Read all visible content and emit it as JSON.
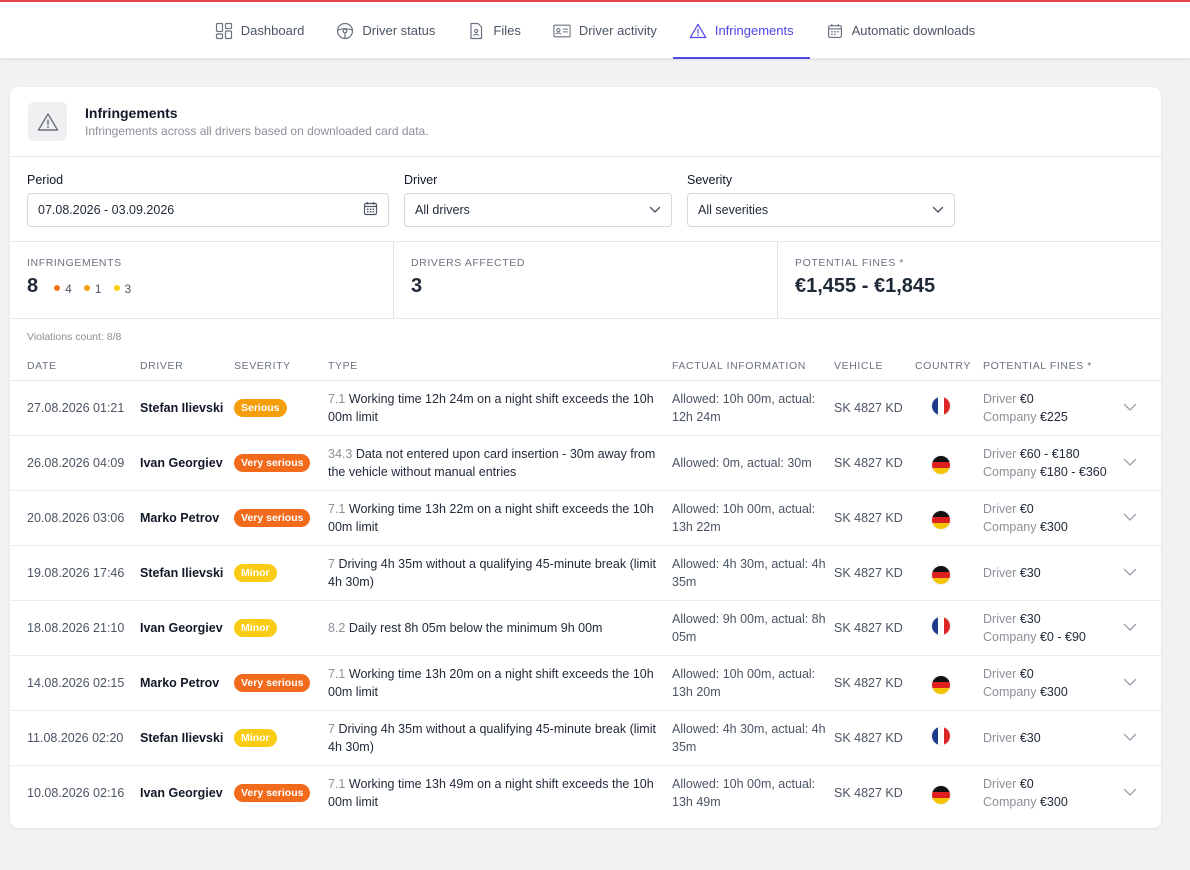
{
  "nav": {
    "tabs": [
      {
        "label": "Dashboard",
        "icon": "dashboard-icon"
      },
      {
        "label": "Driver status",
        "icon": "steering-wheel-icon"
      },
      {
        "label": "Files",
        "icon": "file-icon"
      },
      {
        "label": "Driver activity",
        "icon": "id-card-icon"
      },
      {
        "label": "Infringements",
        "icon": "warning-icon",
        "active": true
      },
      {
        "label": "Automatic downloads",
        "icon": "calendar-icon"
      }
    ]
  },
  "header": {
    "title": "Infringements",
    "subtitle": "Infringements across all drivers based on downloaded card data."
  },
  "filters": {
    "period_label": "Period",
    "period_value": "07.08.2026 - 03.09.2026",
    "driver_label": "Driver",
    "driver_value": "All drivers",
    "severity_label": "Severity",
    "severity_value": "All severities"
  },
  "stats": {
    "infringements_label": "INFRINGEMENTS",
    "infringements_value": "8",
    "breakdown": [
      {
        "count": "4",
        "color": "#f97316"
      },
      {
        "count": "1",
        "color": "#f59e0b"
      },
      {
        "count": "3",
        "color": "#facc15"
      }
    ],
    "drivers_label": "DRIVERS AFFECTED",
    "drivers_value": "3",
    "fines_label": "POTENTIAL FINES *",
    "fines_value": "€1,455 - €1,845"
  },
  "violations_count": "Violations count: 8/8",
  "table": {
    "headers": [
      "DATE",
      "DRIVER",
      "SEVERITY",
      "TYPE",
      "FACTUAL INFORMATION",
      "VEHICLE",
      "COUNTRY",
      "POTENTIAL FINES *"
    ],
    "colors": {
      "Serious": "#f59e0b",
      "Very serious": "#f26a1b",
      "Minor": "#facc15"
    },
    "rows": [
      {
        "date": "27.08.2026 01:21",
        "driver": "Stefan Ilievski",
        "severity": "Serious",
        "code": "7.1",
        "type": "Working time 12h 24m on a night shift exceeds the 10h 00m limit",
        "fact": "Allowed: 10h 00m, actual: 12h 24m",
        "vehicle": "SK 4827 KD",
        "country": "fr",
        "driver_fine_label": "Driver",
        "driver_fine": "€0",
        "company_fine_label": "Company",
        "company_fine": "€225"
      },
      {
        "date": "26.08.2026 04:09",
        "driver": "Ivan Georgiev",
        "severity": "Very serious",
        "code": "34.3",
        "type": "Data not entered upon card insertion - 30m away from the vehicle without manual entries",
        "fact": "Allowed: 0m, actual: 30m",
        "vehicle": "SK 4827 KD",
        "country": "de",
        "driver_fine_label": "Driver",
        "driver_fine": "€60 - €180",
        "company_fine_label": "Company",
        "company_fine": "€180 - €360"
      },
      {
        "date": "20.08.2026 03:06",
        "driver": "Marko Petrov",
        "severity": "Very serious",
        "code": "7.1",
        "type": "Working time 13h 22m on a night shift exceeds the 10h 00m limit",
        "fact": "Allowed: 10h 00m, actual: 13h 22m",
        "vehicle": "SK 4827 KD",
        "country": "de",
        "driver_fine_label": "Driver",
        "driver_fine": "€0",
        "company_fine_label": "Company",
        "company_fine": "€300"
      },
      {
        "date": "19.08.2026 17:46",
        "driver": "Stefan Ilievski",
        "severity": "Minor",
        "code": "7",
        "type": "Driving 4h 35m without a qualifying 45-minute break (limit 4h 30m)",
        "fact": "Allowed: 4h 30m, actual: 4h 35m",
        "vehicle": "SK 4827 KD",
        "country": "de",
        "driver_fine_label": "Driver",
        "driver_fine": "€30",
        "company_fine_label": "",
        "company_fine": ""
      },
      {
        "date": "18.08.2026 21:10",
        "driver": "Ivan Georgiev",
        "severity": "Minor",
        "code": "8.2",
        "type": "Daily rest 8h 05m below the minimum 9h 00m",
        "fact": "Allowed: 9h 00m, actual: 8h 05m",
        "vehicle": "SK 4827 KD",
        "country": "fr",
        "driver_fine_label": "Driver",
        "driver_fine": "€30",
        "company_fine_label": "Company",
        "company_fine": "€0 - €90"
      },
      {
        "date": "14.08.2026 02:15",
        "driver": "Marko Petrov",
        "severity": "Very serious",
        "code": "7.1",
        "type": "Working time 13h 20m on a night shift exceeds the 10h 00m limit",
        "fact": "Allowed: 10h 00m, actual: 13h 20m",
        "vehicle": "SK 4827 KD",
        "country": "de",
        "driver_fine_label": "Driver",
        "driver_fine": "€0",
        "company_fine_label": "Company",
        "company_fine": "€300"
      },
      {
        "date": "11.08.2026 02:20",
        "driver": "Stefan Ilievski",
        "severity": "Minor",
        "code": "7",
        "type": "Driving 4h 35m without a qualifying 45-minute break (limit 4h 30m)",
        "fact": "Allowed: 4h 30m, actual: 4h 35m",
        "vehicle": "SK 4827 KD",
        "country": "fr",
        "driver_fine_label": "Driver",
        "driver_fine": "€30",
        "company_fine_label": "",
        "company_fine": ""
      },
      {
        "date": "10.08.2026 02:16",
        "driver": "Ivan Georgiev",
        "severity": "Very serious",
        "code": "7.1",
        "type": "Working time 13h 49m on a night shift exceeds the 10h 00m limit",
        "fact": "Allowed: 10h 00m, actual: 13h 49m",
        "vehicle": "SK 4827 KD",
        "country": "de",
        "driver_fine_label": "Driver",
        "driver_fine": "€0",
        "company_fine_label": "Company",
        "company_fine": "€300"
      }
    ]
  }
}
